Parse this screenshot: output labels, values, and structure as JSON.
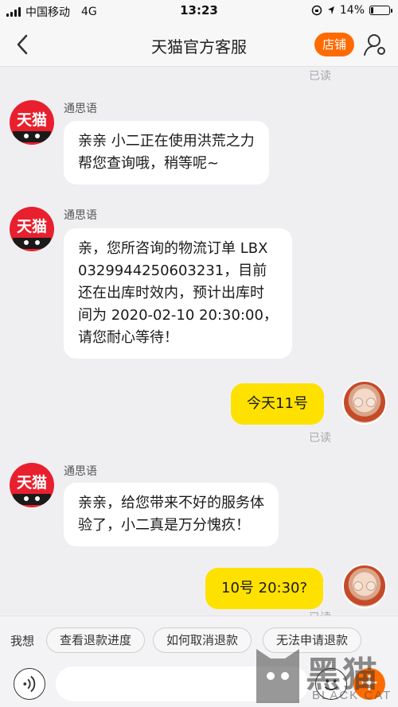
{
  "status_bar": {
    "carrier": "中国移动",
    "network": "4G",
    "time": "13:23",
    "battery": "14%",
    "battery_level": 0.14
  },
  "header": {
    "title": "天猫官方客服",
    "store_button": "店铺",
    "accent_color": "#ff6b00"
  },
  "messages": {
    "read_top": "已读",
    "m1": {
      "sender": "通思语",
      "avatar_text": "天猫",
      "line1": "亲亲 小二正在使用洪荒之力",
      "line2": "帮您查询哦，稍等呢~"
    },
    "m2": {
      "sender": "通思语",
      "avatar_text": "天猫",
      "line1": "亲，您所咨询的物流订单 LBX",
      "line2": "0329944250603231，目前",
      "line3": "还在出库时效内，预计出库时",
      "line4": "间为 2020-02-10 20:30:00，",
      "line5": "请您耐心等待！"
    },
    "m3": {
      "text": "今天11号",
      "status": "已读"
    },
    "m4": {
      "sender": "通思语",
      "avatar_text": "天猫",
      "line1": "亲亲，给您带来不好的服务体",
      "line2": "验了，小二真是万分愧疚！"
    },
    "m5": {
      "text": "10号 20:30?",
      "status": "已读"
    }
  },
  "quick_replies": {
    "label": "我想",
    "items": [
      "查看退款进度",
      "如何取消退款",
      "无法申请退款"
    ]
  },
  "input": {
    "placeholder": ""
  },
  "icons": [
    "back-chevron-icon",
    "user-settings-icon",
    "voice-icon",
    "emoji-icon",
    "plus-icon"
  ],
  "watermark": {
    "cn": "黑猫",
    "en": "BLACK CAT"
  }
}
